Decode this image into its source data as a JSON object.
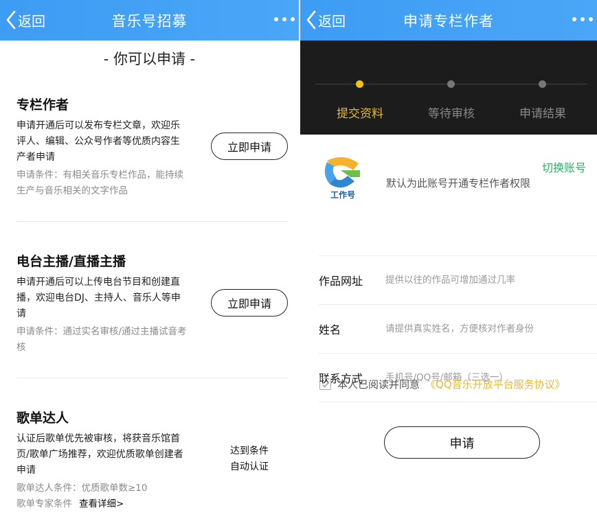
{
  "left": {
    "nav": {
      "back_label": "返回",
      "title": "音乐号招募"
    },
    "section_header": "- 你可以申请 -",
    "roles": [
      {
        "title": "专栏作者",
        "description": "申请开通后可以发布专栏文章，欢迎乐评人、编辑、公众号作者等优质内容生产者申请",
        "condition": "申请条件：有相关音乐专栏作品，能持续生产与音乐相关的文字作品",
        "button": "立即申请"
      },
      {
        "title": "电台主播/直播主播",
        "description": "申请开通后可以上传电台节目和创建直播，欢迎电台DJ、主持人、音乐人等申请",
        "condition": "申请条件：通过实名审核/通过主播试音考核",
        "button": "立即申请"
      },
      {
        "title": "歌单达人",
        "description": "认证后歌单优先被审核，将获音乐馆首页/歌单广场推荐，欢迎优质歌单创建者申请",
        "condition1": "歌单达人条件：优质歌单数≥10",
        "condition2_prefix": "歌单专家条件",
        "condition2_link": "查看详细>",
        "auto_line1": "达到条件",
        "auto_line2": "自动认证"
      }
    ]
  },
  "right": {
    "nav": {
      "back_label": "返回",
      "title": "申请专栏作者"
    },
    "steps": [
      {
        "label": "提交资料",
        "active": true
      },
      {
        "label": "等待审核",
        "active": false
      },
      {
        "label": "申请结果",
        "active": false
      }
    ],
    "account": {
      "logo_text": "工作号",
      "switch_label": "切换账号",
      "note": "默认为此账号开通专栏作者权限"
    },
    "form": [
      {
        "label": "作品网址",
        "placeholder": "提供以往的作品可增加通过几率"
      },
      {
        "label": "姓名",
        "placeholder": "请提供真实姓名，方便核对作者身份"
      },
      {
        "label": "联系方式",
        "placeholder": "手机号/QQ号/邮箱（三选一）"
      }
    ],
    "agreement": {
      "text": "本人已阅读并同意",
      "link": "《QQ音乐开放平台服务协议》",
      "checked": true
    },
    "submit_label": "申请"
  },
  "colors": {
    "nav_blue": "#3d9cf3",
    "step_active": "#f1c40f",
    "link_gold": "#e9b92c",
    "switch_green": "#2bb168"
  },
  "icons": [
    "chevron-left-icon",
    "more-dots-icon",
    "checkbox-icon",
    "app-logo-icon"
  ]
}
